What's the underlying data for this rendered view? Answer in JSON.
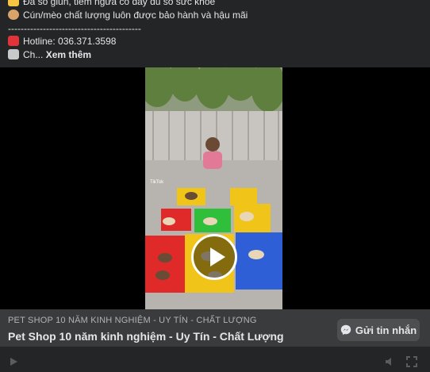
{
  "post": {
    "line1": "Đa số giun, tiêm ngừa có đầy đủ sổ sức khỏe",
    "line2": "Cún/mèo chất lượng luôn được bảo hành và hậu mãi",
    "divider": "------------------------------------------",
    "hotline": "Hotline: 036.371.3598",
    "line5_prefix": "Ch...",
    "see_more": "Xem thêm"
  },
  "video": {
    "watermark": "TikTok"
  },
  "footer": {
    "page_subtitle": "PET SHOP 10 NĂM KINH NGHIỆM - UY TÍN - CHẤT LƯỢNG",
    "page_title": "Pet Shop 10 năm kinh nghiệm - Uy Tín - Chất Lượng",
    "message_button": "Gửi tin nhắn"
  },
  "icons": {
    "line1": "pointing-hand-icon",
    "line2": "cat-face-icon",
    "hotline": "telephone-icon",
    "line5": "house-icon",
    "play": "play-icon",
    "messenger": "messenger-icon"
  },
  "colors": {
    "background": "#242526",
    "footer": "#3a3b3c",
    "button": "#4e4f50",
    "text": "#e4e6eb",
    "muted": "#b0b3b8"
  }
}
